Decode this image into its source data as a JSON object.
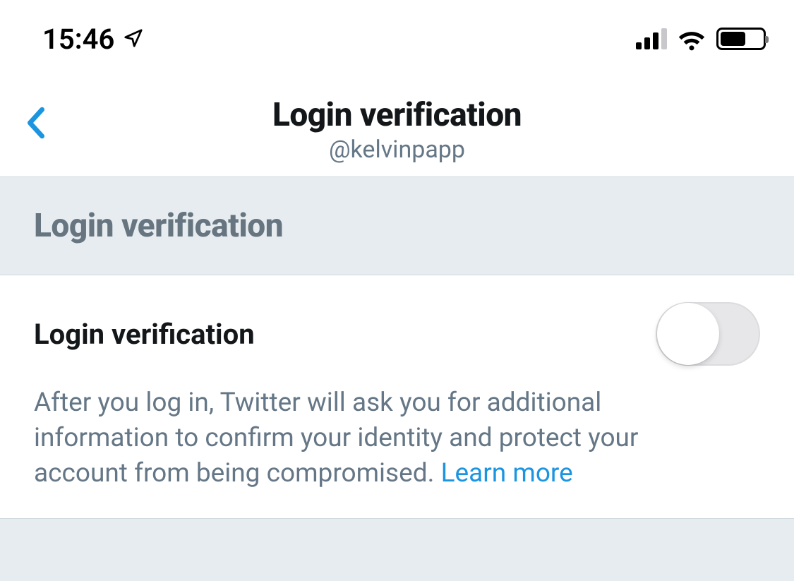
{
  "status": {
    "time": "15:46"
  },
  "header": {
    "title": "Login verification",
    "subtitle": "@kelvinpapp"
  },
  "section": {
    "title": "Login verification"
  },
  "setting": {
    "label": "Login verification",
    "description": "After you log in, Twitter will ask you for additional information to confirm your identity and protect your account from being compromised. ",
    "learn_more": "Learn more",
    "enabled": false
  }
}
